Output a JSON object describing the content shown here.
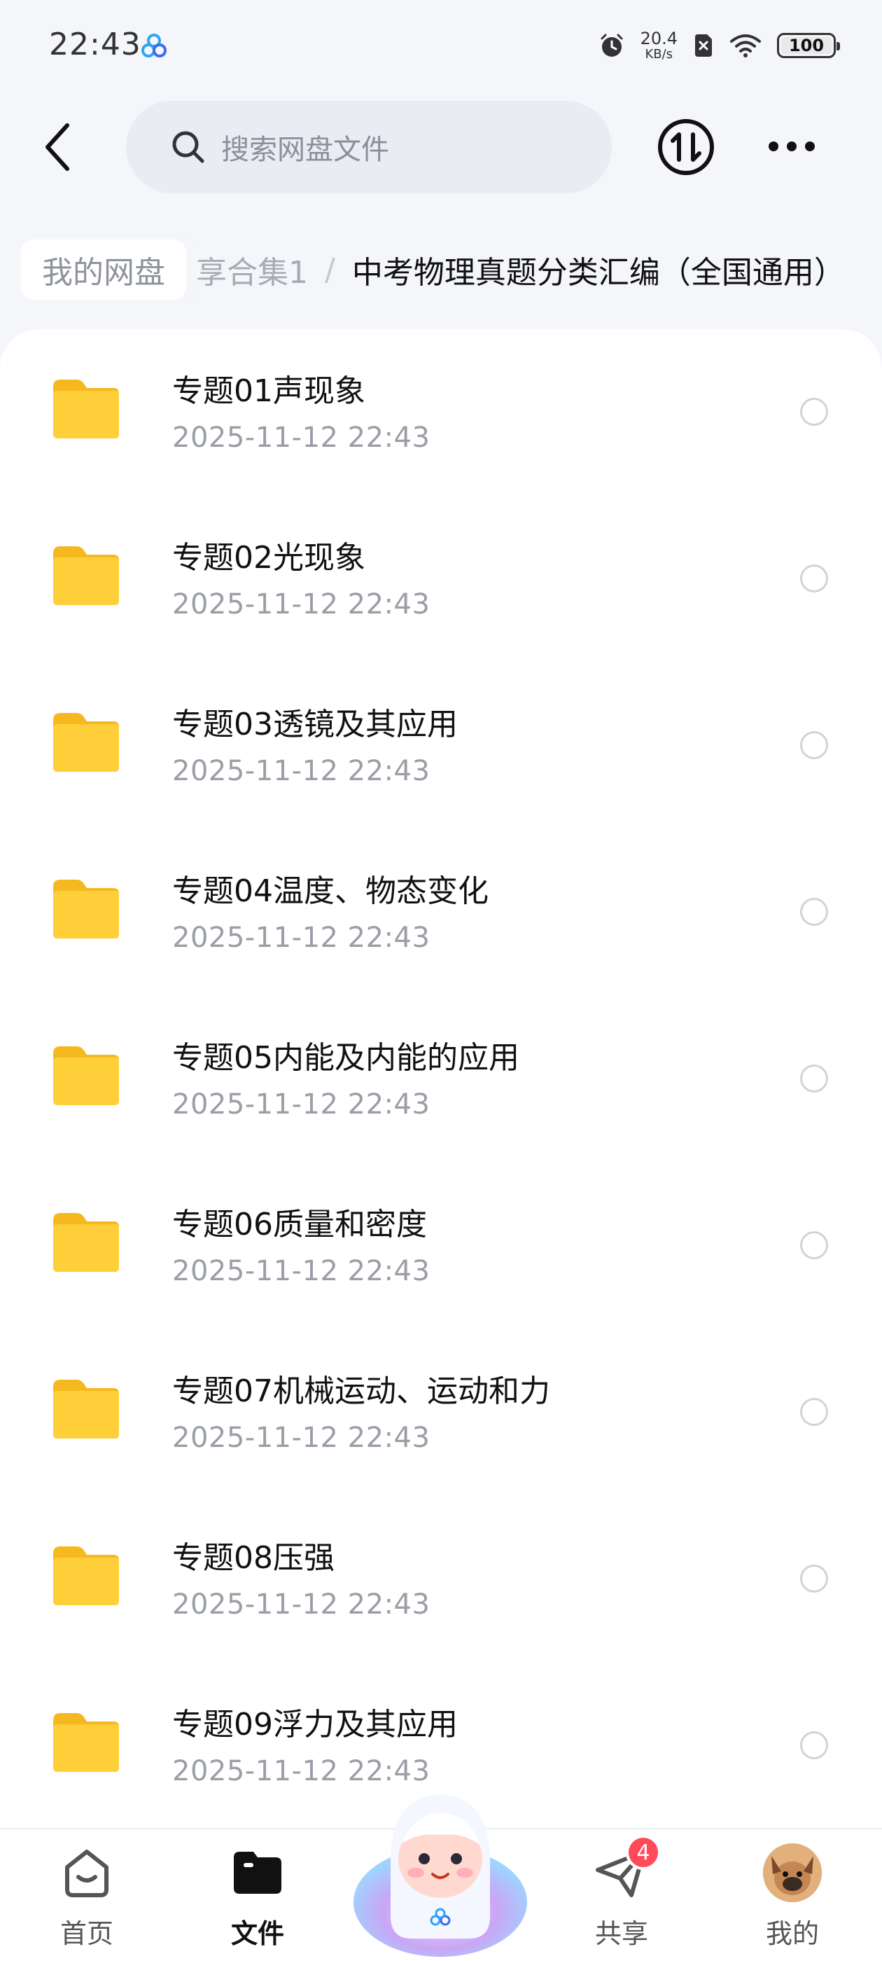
{
  "status_bar": {
    "time": "22:43",
    "net_speed": "20.4",
    "net_unit": "KB/s",
    "battery": "100",
    "icons": [
      "app-logo-icon",
      "alarm-icon",
      "sim-off-icon",
      "wifi-icon",
      "battery-icon"
    ]
  },
  "header": {
    "search_placeholder": "搜索网盘文件",
    "icons": [
      "back-icon",
      "search-icon",
      "transfer-icon",
      "more-icon"
    ]
  },
  "breadcrumb": {
    "root": "我的网盘",
    "middle": "享合集1",
    "separator": "/",
    "current": "中考物理真题分类汇编（全国通用）"
  },
  "files": [
    {
      "name": "专题01声现象",
      "date": "2025-11-12  22:43"
    },
    {
      "name": "专题02光现象",
      "date": "2025-11-12  22:43"
    },
    {
      "name": "专题03透镜及其应用",
      "date": "2025-11-12  22:43"
    },
    {
      "name": "专题04温度、物态变化",
      "date": "2025-11-12  22:43"
    },
    {
      "name": "专题05内能及内能的应用",
      "date": "2025-11-12  22:43"
    },
    {
      "name": "专题06质量和密度",
      "date": "2025-11-12  22:43"
    },
    {
      "name": "专题07机械运动、运动和力",
      "date": "2025-11-12  22:43"
    },
    {
      "name": "专题08压强",
      "date": "2025-11-12  22:43"
    },
    {
      "name": "专题09浮力及其应用",
      "date": "2025-11-12  22:43"
    }
  ],
  "bottom_nav": {
    "home": "首页",
    "files": "文件",
    "share": "共享",
    "share_badge": "4",
    "mine": "我的",
    "active": "files"
  },
  "colors": {
    "folder": "#ffcf3a",
    "badge": "#ff4a5a",
    "search_bg": "#e9ecf3"
  }
}
